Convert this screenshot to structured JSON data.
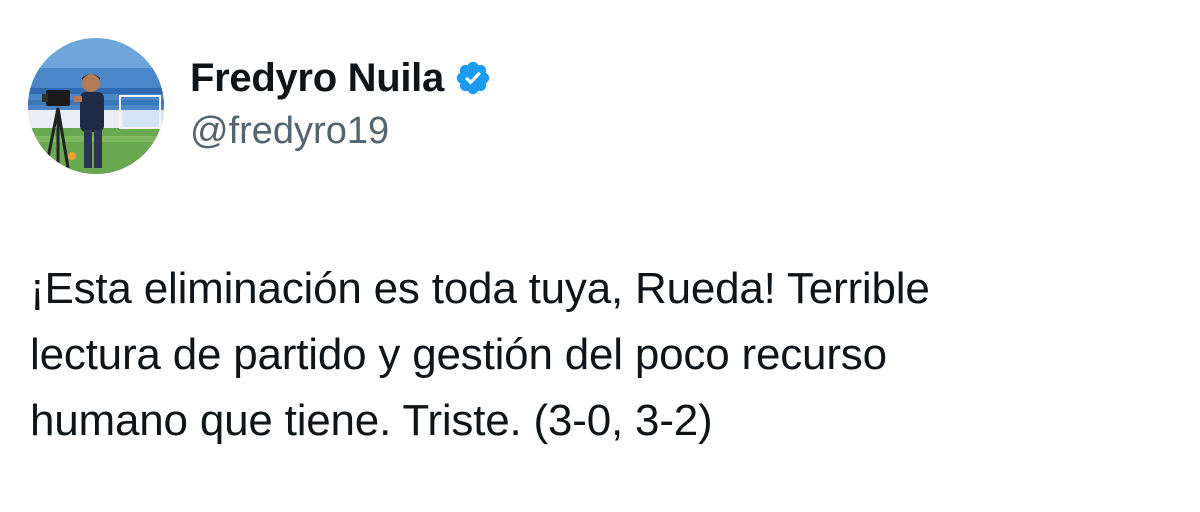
{
  "author": {
    "display_name": "Fredyro Nuila",
    "handle": "@fredyro19",
    "verified": true,
    "verified_icon": "verified-badge-icon",
    "verified_color": "#1d9bf0",
    "avatar": "profile-photo"
  },
  "tweet": {
    "lines": [
      "¡Esta eliminación es toda tuya, Rueda! Terrible",
      "lectura de partido y gestión del poco recurso",
      "humano que tiene. Triste. (3-0, 3-2)"
    ]
  },
  "colors": {
    "text": "#0f1419",
    "secondary_text": "#536471",
    "background": "#ffffff"
  }
}
